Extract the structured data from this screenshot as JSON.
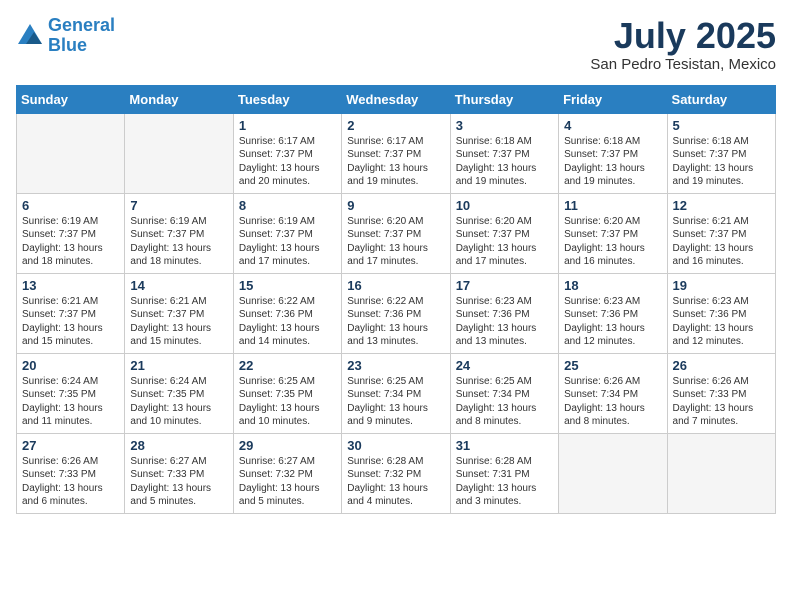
{
  "header": {
    "logo_line1": "General",
    "logo_line2": "Blue",
    "month_title": "July 2025",
    "location": "San Pedro Tesistan, Mexico"
  },
  "weekdays": [
    "Sunday",
    "Monday",
    "Tuesday",
    "Wednesday",
    "Thursday",
    "Friday",
    "Saturday"
  ],
  "weeks": [
    [
      {
        "day": "",
        "info": ""
      },
      {
        "day": "",
        "info": ""
      },
      {
        "day": "1",
        "info": "Sunrise: 6:17 AM\nSunset: 7:37 PM\nDaylight: 13 hours\nand 20 minutes."
      },
      {
        "day": "2",
        "info": "Sunrise: 6:17 AM\nSunset: 7:37 PM\nDaylight: 13 hours\nand 19 minutes."
      },
      {
        "day": "3",
        "info": "Sunrise: 6:18 AM\nSunset: 7:37 PM\nDaylight: 13 hours\nand 19 minutes."
      },
      {
        "day": "4",
        "info": "Sunrise: 6:18 AM\nSunset: 7:37 PM\nDaylight: 13 hours\nand 19 minutes."
      },
      {
        "day": "5",
        "info": "Sunrise: 6:18 AM\nSunset: 7:37 PM\nDaylight: 13 hours\nand 19 minutes."
      }
    ],
    [
      {
        "day": "6",
        "info": "Sunrise: 6:19 AM\nSunset: 7:37 PM\nDaylight: 13 hours\nand 18 minutes."
      },
      {
        "day": "7",
        "info": "Sunrise: 6:19 AM\nSunset: 7:37 PM\nDaylight: 13 hours\nand 18 minutes."
      },
      {
        "day": "8",
        "info": "Sunrise: 6:19 AM\nSunset: 7:37 PM\nDaylight: 13 hours\nand 17 minutes."
      },
      {
        "day": "9",
        "info": "Sunrise: 6:20 AM\nSunset: 7:37 PM\nDaylight: 13 hours\nand 17 minutes."
      },
      {
        "day": "10",
        "info": "Sunrise: 6:20 AM\nSunset: 7:37 PM\nDaylight: 13 hours\nand 17 minutes."
      },
      {
        "day": "11",
        "info": "Sunrise: 6:20 AM\nSunset: 7:37 PM\nDaylight: 13 hours\nand 16 minutes."
      },
      {
        "day": "12",
        "info": "Sunrise: 6:21 AM\nSunset: 7:37 PM\nDaylight: 13 hours\nand 16 minutes."
      }
    ],
    [
      {
        "day": "13",
        "info": "Sunrise: 6:21 AM\nSunset: 7:37 PM\nDaylight: 13 hours\nand 15 minutes."
      },
      {
        "day": "14",
        "info": "Sunrise: 6:21 AM\nSunset: 7:37 PM\nDaylight: 13 hours\nand 15 minutes."
      },
      {
        "day": "15",
        "info": "Sunrise: 6:22 AM\nSunset: 7:36 PM\nDaylight: 13 hours\nand 14 minutes."
      },
      {
        "day": "16",
        "info": "Sunrise: 6:22 AM\nSunset: 7:36 PM\nDaylight: 13 hours\nand 13 minutes."
      },
      {
        "day": "17",
        "info": "Sunrise: 6:23 AM\nSunset: 7:36 PM\nDaylight: 13 hours\nand 13 minutes."
      },
      {
        "day": "18",
        "info": "Sunrise: 6:23 AM\nSunset: 7:36 PM\nDaylight: 13 hours\nand 12 minutes."
      },
      {
        "day": "19",
        "info": "Sunrise: 6:23 AM\nSunset: 7:36 PM\nDaylight: 13 hours\nand 12 minutes."
      }
    ],
    [
      {
        "day": "20",
        "info": "Sunrise: 6:24 AM\nSunset: 7:35 PM\nDaylight: 13 hours\nand 11 minutes."
      },
      {
        "day": "21",
        "info": "Sunrise: 6:24 AM\nSunset: 7:35 PM\nDaylight: 13 hours\nand 10 minutes."
      },
      {
        "day": "22",
        "info": "Sunrise: 6:25 AM\nSunset: 7:35 PM\nDaylight: 13 hours\nand 10 minutes."
      },
      {
        "day": "23",
        "info": "Sunrise: 6:25 AM\nSunset: 7:34 PM\nDaylight: 13 hours\nand 9 minutes."
      },
      {
        "day": "24",
        "info": "Sunrise: 6:25 AM\nSunset: 7:34 PM\nDaylight: 13 hours\nand 8 minutes."
      },
      {
        "day": "25",
        "info": "Sunrise: 6:26 AM\nSunset: 7:34 PM\nDaylight: 13 hours\nand 8 minutes."
      },
      {
        "day": "26",
        "info": "Sunrise: 6:26 AM\nSunset: 7:33 PM\nDaylight: 13 hours\nand 7 minutes."
      }
    ],
    [
      {
        "day": "27",
        "info": "Sunrise: 6:26 AM\nSunset: 7:33 PM\nDaylight: 13 hours\nand 6 minutes."
      },
      {
        "day": "28",
        "info": "Sunrise: 6:27 AM\nSunset: 7:33 PM\nDaylight: 13 hours\nand 5 minutes."
      },
      {
        "day": "29",
        "info": "Sunrise: 6:27 AM\nSunset: 7:32 PM\nDaylight: 13 hours\nand 5 minutes."
      },
      {
        "day": "30",
        "info": "Sunrise: 6:28 AM\nSunset: 7:32 PM\nDaylight: 13 hours\nand 4 minutes."
      },
      {
        "day": "31",
        "info": "Sunrise: 6:28 AM\nSunset: 7:31 PM\nDaylight: 13 hours\nand 3 minutes."
      },
      {
        "day": "",
        "info": ""
      },
      {
        "day": "",
        "info": ""
      }
    ]
  ]
}
